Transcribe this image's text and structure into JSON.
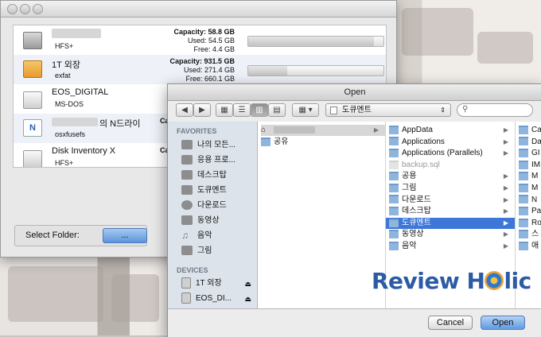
{
  "colors": {
    "accent": "#3d77d8",
    "button_blue": "#5f9be3",
    "watermark": "#2c5ba6"
  },
  "disk_window": {
    "disks": [
      {
        "name": "",
        "fs": "HFS+",
        "icon": "hard-drive-icon",
        "capacity_label": "Capacity: 58.8 GB",
        "used_label": "Used: 54.5 GB",
        "free_label": "Free: 4.4 GB",
        "used_fraction": 0.93
      },
      {
        "name": "1T 외장",
        "fs": "exfat",
        "icon": "usb-drive-icon",
        "capacity_label": "Capacity: 931.5 GB",
        "used_label": "Used: 271.4 GB",
        "free_label": "Free: 660.1 GB",
        "used_fraction": 0.29
      },
      {
        "name": "EOS_DIGITAL",
        "fs": "MS-DOS",
        "icon": "drive-icon"
      },
      {
        "name": "의 N드라이",
        "fs": "osxfusefs",
        "icon": "network-drive-icon",
        "stat_partial": "Ca"
      },
      {
        "name": "Disk Inventory X",
        "fs": "HFS+",
        "icon": "drive-icon",
        "stat_partial": "Ca"
      }
    ],
    "footer": {
      "label": "Select Folder:",
      "button": "..."
    }
  },
  "open_dialog": {
    "title": "Open",
    "path_popup": "도큐멘트",
    "sidebar": {
      "favorites_header": "FAVORITES",
      "favorites": [
        {
          "label": "나의 모든...",
          "icon": "all-my-files-icon"
        },
        {
          "label": "응용 프로...",
          "icon": "applications-icon"
        },
        {
          "label": "데스크탑",
          "icon": "desktop-icon"
        },
        {
          "label": "도큐멘트",
          "icon": "documents-icon"
        },
        {
          "label": "다운로드",
          "icon": "downloads-icon"
        },
        {
          "label": "동영상",
          "icon": "movies-icon"
        },
        {
          "label": "음악",
          "icon": "music-icon"
        },
        {
          "label": "그림",
          "icon": "pictures-icon"
        }
      ],
      "devices_header": "DEVICES",
      "devices": [
        {
          "label": "1T 외장",
          "icon": "drive-icon"
        },
        {
          "label": "EOS_DI...",
          "icon": "drive-icon"
        }
      ]
    },
    "column1": [
      {
        "label": "",
        "icon": "home-icon"
      },
      {
        "label": "공유",
        "icon": "folder-icon"
      }
    ],
    "column2": [
      {
        "label": "AppData",
        "arrow": true
      },
      {
        "label": "Applications",
        "arrow": true
      },
      {
        "label": "Applications (Parallels)",
        "arrow": true
      },
      {
        "label": "backup.sql",
        "arrow": false,
        "dim": true
      },
      {
        "label": "공용",
        "arrow": true
      },
      {
        "label": "그림",
        "arrow": true
      },
      {
        "label": "다운로드",
        "arrow": true
      },
      {
        "label": "데스크탑",
        "arrow": true
      },
      {
        "label": "도큐멘트",
        "arrow": true,
        "selected": true
      },
      {
        "label": "동영상",
        "arrow": true
      },
      {
        "label": "음악",
        "arrow": true
      }
    ],
    "column3": [
      "Ca",
      "Da",
      "GI",
      "IM",
      "M",
      "M",
      "N",
      "Pa",
      "Ro",
      "스",
      "애"
    ],
    "buttons": {
      "cancel": "Cancel",
      "open": "Open"
    }
  },
  "watermark": {
    "left": "Review H",
    "right": "lic"
  }
}
